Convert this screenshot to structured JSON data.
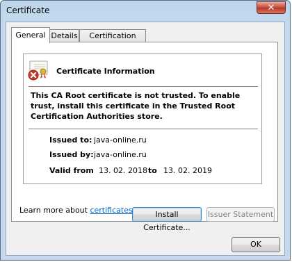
{
  "window": {
    "title": "Certificate",
    "close_label": "✕"
  },
  "tabs": [
    {
      "label": "General"
    },
    {
      "label": "Details"
    },
    {
      "label": "Certification Path"
    }
  ],
  "info": {
    "title": "Certificate Information",
    "warning": "This CA Root certificate is not trusted. To enable trust, install this certificate in the Trusted Root Certification Authorities store.",
    "issued_to_label": "Issued to:",
    "issued_to_value": "java-online.ru",
    "issued_by_label": "Issued by:",
    "issued_by_value": "java-online.ru",
    "valid_from_label": "Valid from",
    "valid_from_value": "13. 02. 2018",
    "valid_to_label": "to",
    "valid_to_value": "13. 02. 2019",
    "icon": "certificate-error-icon"
  },
  "buttons": {
    "install": "Install Certificate...",
    "issuer_statement": "Issuer Statement",
    "ok": "OK"
  },
  "learn_more": {
    "prefix": "Learn more about ",
    "link": "certificates"
  }
}
